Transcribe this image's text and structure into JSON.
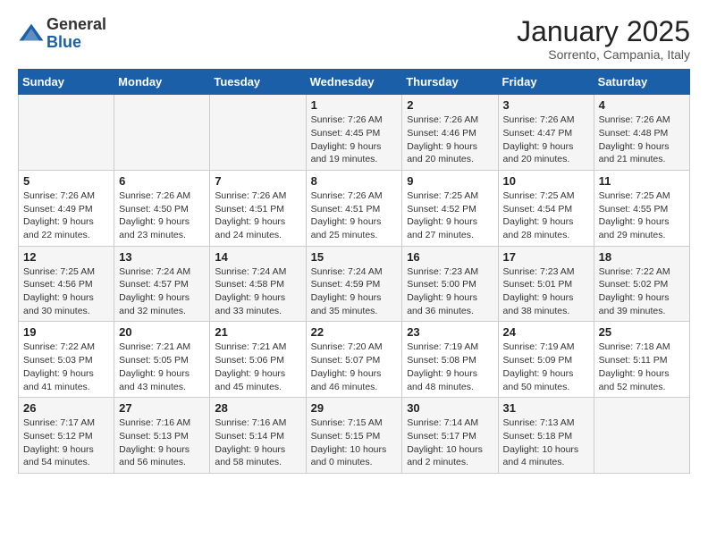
{
  "logo": {
    "general": "General",
    "blue": "Blue"
  },
  "header": {
    "month": "January 2025",
    "location": "Sorrento, Campania, Italy"
  },
  "weekdays": [
    "Sunday",
    "Monday",
    "Tuesday",
    "Wednesday",
    "Thursday",
    "Friday",
    "Saturday"
  ],
  "weeks": [
    [
      {
        "day": "",
        "info": ""
      },
      {
        "day": "",
        "info": ""
      },
      {
        "day": "",
        "info": ""
      },
      {
        "day": "1",
        "info": "Sunrise: 7:26 AM\nSunset: 4:45 PM\nDaylight: 9 hours\nand 19 minutes."
      },
      {
        "day": "2",
        "info": "Sunrise: 7:26 AM\nSunset: 4:46 PM\nDaylight: 9 hours\nand 20 minutes."
      },
      {
        "day": "3",
        "info": "Sunrise: 7:26 AM\nSunset: 4:47 PM\nDaylight: 9 hours\nand 20 minutes."
      },
      {
        "day": "4",
        "info": "Sunrise: 7:26 AM\nSunset: 4:48 PM\nDaylight: 9 hours\nand 21 minutes."
      }
    ],
    [
      {
        "day": "5",
        "info": "Sunrise: 7:26 AM\nSunset: 4:49 PM\nDaylight: 9 hours\nand 22 minutes."
      },
      {
        "day": "6",
        "info": "Sunrise: 7:26 AM\nSunset: 4:50 PM\nDaylight: 9 hours\nand 23 minutes."
      },
      {
        "day": "7",
        "info": "Sunrise: 7:26 AM\nSunset: 4:51 PM\nDaylight: 9 hours\nand 24 minutes."
      },
      {
        "day": "8",
        "info": "Sunrise: 7:26 AM\nSunset: 4:51 PM\nDaylight: 9 hours\nand 25 minutes."
      },
      {
        "day": "9",
        "info": "Sunrise: 7:25 AM\nSunset: 4:52 PM\nDaylight: 9 hours\nand 27 minutes."
      },
      {
        "day": "10",
        "info": "Sunrise: 7:25 AM\nSunset: 4:54 PM\nDaylight: 9 hours\nand 28 minutes."
      },
      {
        "day": "11",
        "info": "Sunrise: 7:25 AM\nSunset: 4:55 PM\nDaylight: 9 hours\nand 29 minutes."
      }
    ],
    [
      {
        "day": "12",
        "info": "Sunrise: 7:25 AM\nSunset: 4:56 PM\nDaylight: 9 hours\nand 30 minutes."
      },
      {
        "day": "13",
        "info": "Sunrise: 7:24 AM\nSunset: 4:57 PM\nDaylight: 9 hours\nand 32 minutes."
      },
      {
        "day": "14",
        "info": "Sunrise: 7:24 AM\nSunset: 4:58 PM\nDaylight: 9 hours\nand 33 minutes."
      },
      {
        "day": "15",
        "info": "Sunrise: 7:24 AM\nSunset: 4:59 PM\nDaylight: 9 hours\nand 35 minutes."
      },
      {
        "day": "16",
        "info": "Sunrise: 7:23 AM\nSunset: 5:00 PM\nDaylight: 9 hours\nand 36 minutes."
      },
      {
        "day": "17",
        "info": "Sunrise: 7:23 AM\nSunset: 5:01 PM\nDaylight: 9 hours\nand 38 minutes."
      },
      {
        "day": "18",
        "info": "Sunrise: 7:22 AM\nSunset: 5:02 PM\nDaylight: 9 hours\nand 39 minutes."
      }
    ],
    [
      {
        "day": "19",
        "info": "Sunrise: 7:22 AM\nSunset: 5:03 PM\nDaylight: 9 hours\nand 41 minutes."
      },
      {
        "day": "20",
        "info": "Sunrise: 7:21 AM\nSunset: 5:05 PM\nDaylight: 9 hours\nand 43 minutes."
      },
      {
        "day": "21",
        "info": "Sunrise: 7:21 AM\nSunset: 5:06 PM\nDaylight: 9 hours\nand 45 minutes."
      },
      {
        "day": "22",
        "info": "Sunrise: 7:20 AM\nSunset: 5:07 PM\nDaylight: 9 hours\nand 46 minutes."
      },
      {
        "day": "23",
        "info": "Sunrise: 7:19 AM\nSunset: 5:08 PM\nDaylight: 9 hours\nand 48 minutes."
      },
      {
        "day": "24",
        "info": "Sunrise: 7:19 AM\nSunset: 5:09 PM\nDaylight: 9 hours\nand 50 minutes."
      },
      {
        "day": "25",
        "info": "Sunrise: 7:18 AM\nSunset: 5:11 PM\nDaylight: 9 hours\nand 52 minutes."
      }
    ],
    [
      {
        "day": "26",
        "info": "Sunrise: 7:17 AM\nSunset: 5:12 PM\nDaylight: 9 hours\nand 54 minutes."
      },
      {
        "day": "27",
        "info": "Sunrise: 7:16 AM\nSunset: 5:13 PM\nDaylight: 9 hours\nand 56 minutes."
      },
      {
        "day": "28",
        "info": "Sunrise: 7:16 AM\nSunset: 5:14 PM\nDaylight: 9 hours\nand 58 minutes."
      },
      {
        "day": "29",
        "info": "Sunrise: 7:15 AM\nSunset: 5:15 PM\nDaylight: 10 hours\nand 0 minutes."
      },
      {
        "day": "30",
        "info": "Sunrise: 7:14 AM\nSunset: 5:17 PM\nDaylight: 10 hours\nand 2 minutes."
      },
      {
        "day": "31",
        "info": "Sunrise: 7:13 AM\nSunset: 5:18 PM\nDaylight: 10 hours\nand 4 minutes."
      },
      {
        "day": "",
        "info": ""
      }
    ]
  ]
}
